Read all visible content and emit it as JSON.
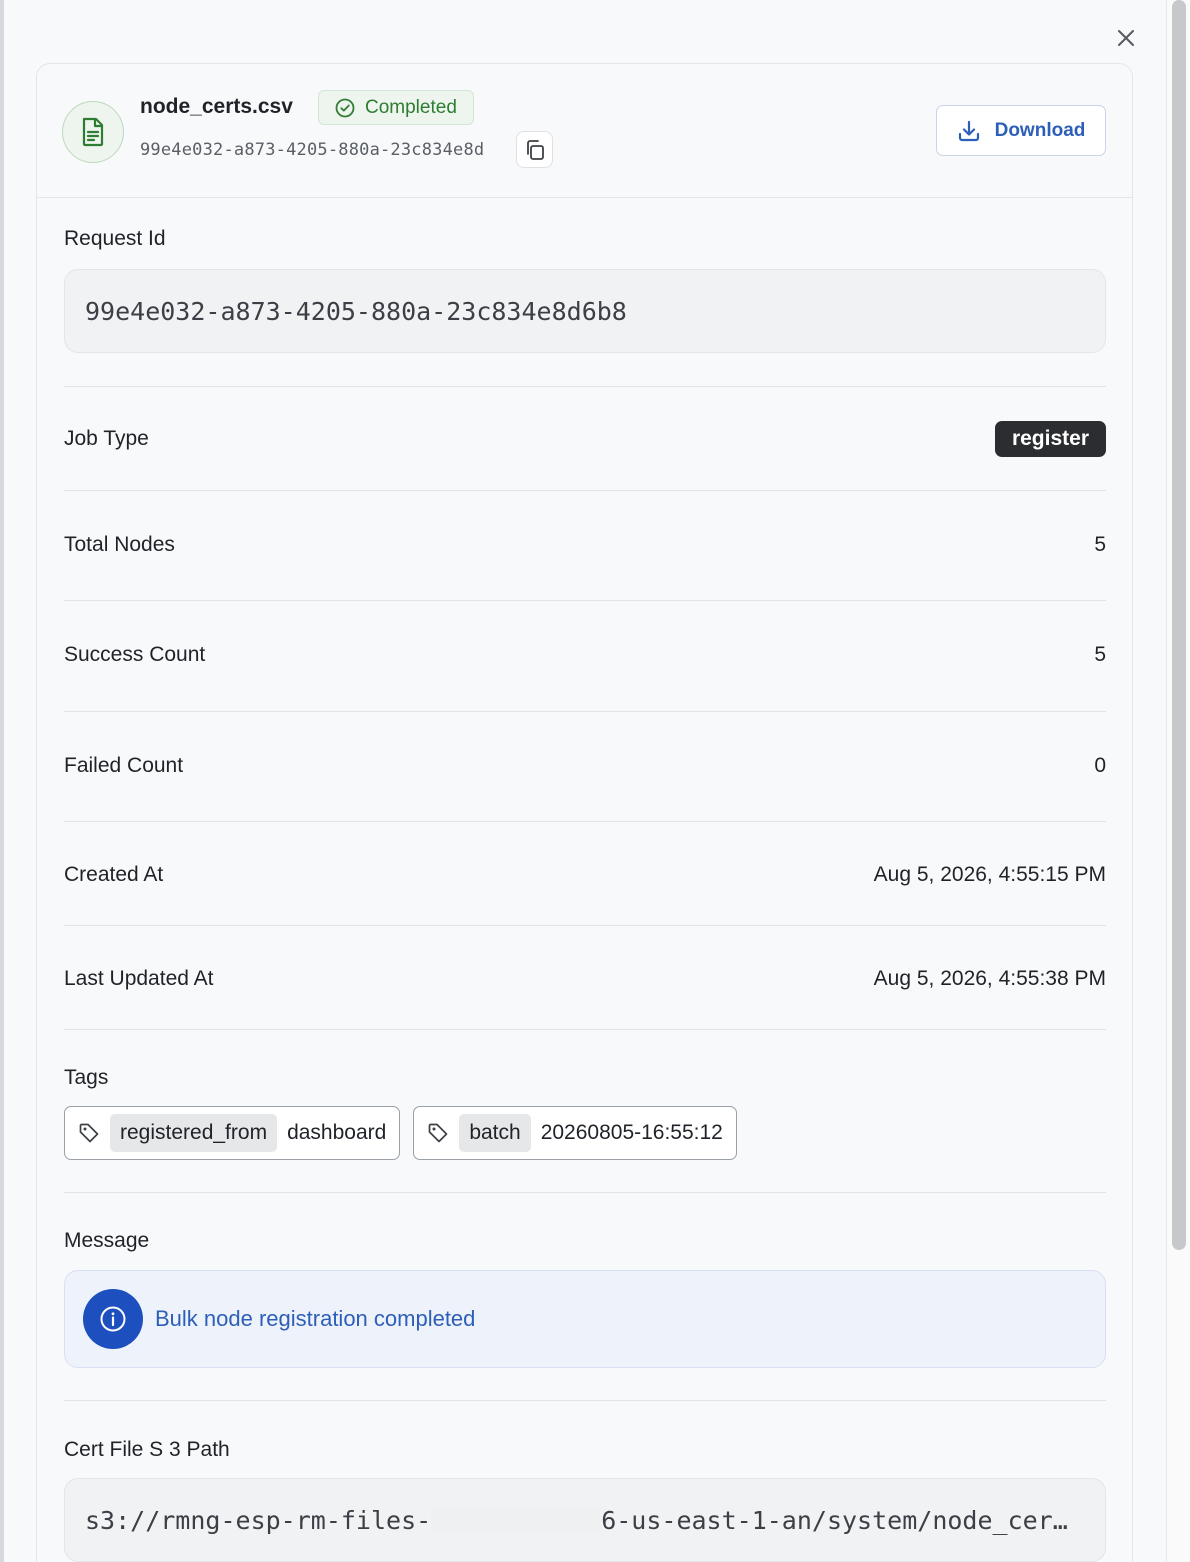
{
  "header": {
    "file_name": "node_certs.csv",
    "status": "Completed",
    "job_id": "99e4e032-a873-4205-880a-23c834e8d",
    "download_label": "Download"
  },
  "fields": {
    "request_id": {
      "label": "Request Id",
      "value": "99e4e032-a873-4205-880a-23c834e8d6b8"
    },
    "job_type": {
      "label": "Job Type",
      "value": "register"
    },
    "total_nodes": {
      "label": "Total Nodes",
      "value": "5"
    },
    "success_count": {
      "label": "Success Count",
      "value": "5"
    },
    "failed_count": {
      "label": "Failed Count",
      "value": "0"
    },
    "created_at": {
      "label": "Created At",
      "value": "Aug 5, 2026, 4:55:15 PM"
    },
    "last_updated_at": {
      "label": "Last Updated At",
      "value": "Aug 5, 2026, 4:55:38 PM"
    }
  },
  "tags": {
    "label": "Tags",
    "items": [
      {
        "key": "registered_from",
        "value": "dashboard"
      },
      {
        "key": "batch",
        "value": "20260805-16:55:12"
      }
    ]
  },
  "message": {
    "label": "Message",
    "text": "Bulk node registration completed"
  },
  "cert_path": {
    "label": "Cert File S 3 Path",
    "prefix": "s3://rmng-esp-rm-files-",
    "suffix": "6-us-east-1-an/system/node_cer…"
  },
  "colors": {
    "accent": "#2d5fb8",
    "success": "#2e7d32",
    "info": "#1e4fbf"
  }
}
